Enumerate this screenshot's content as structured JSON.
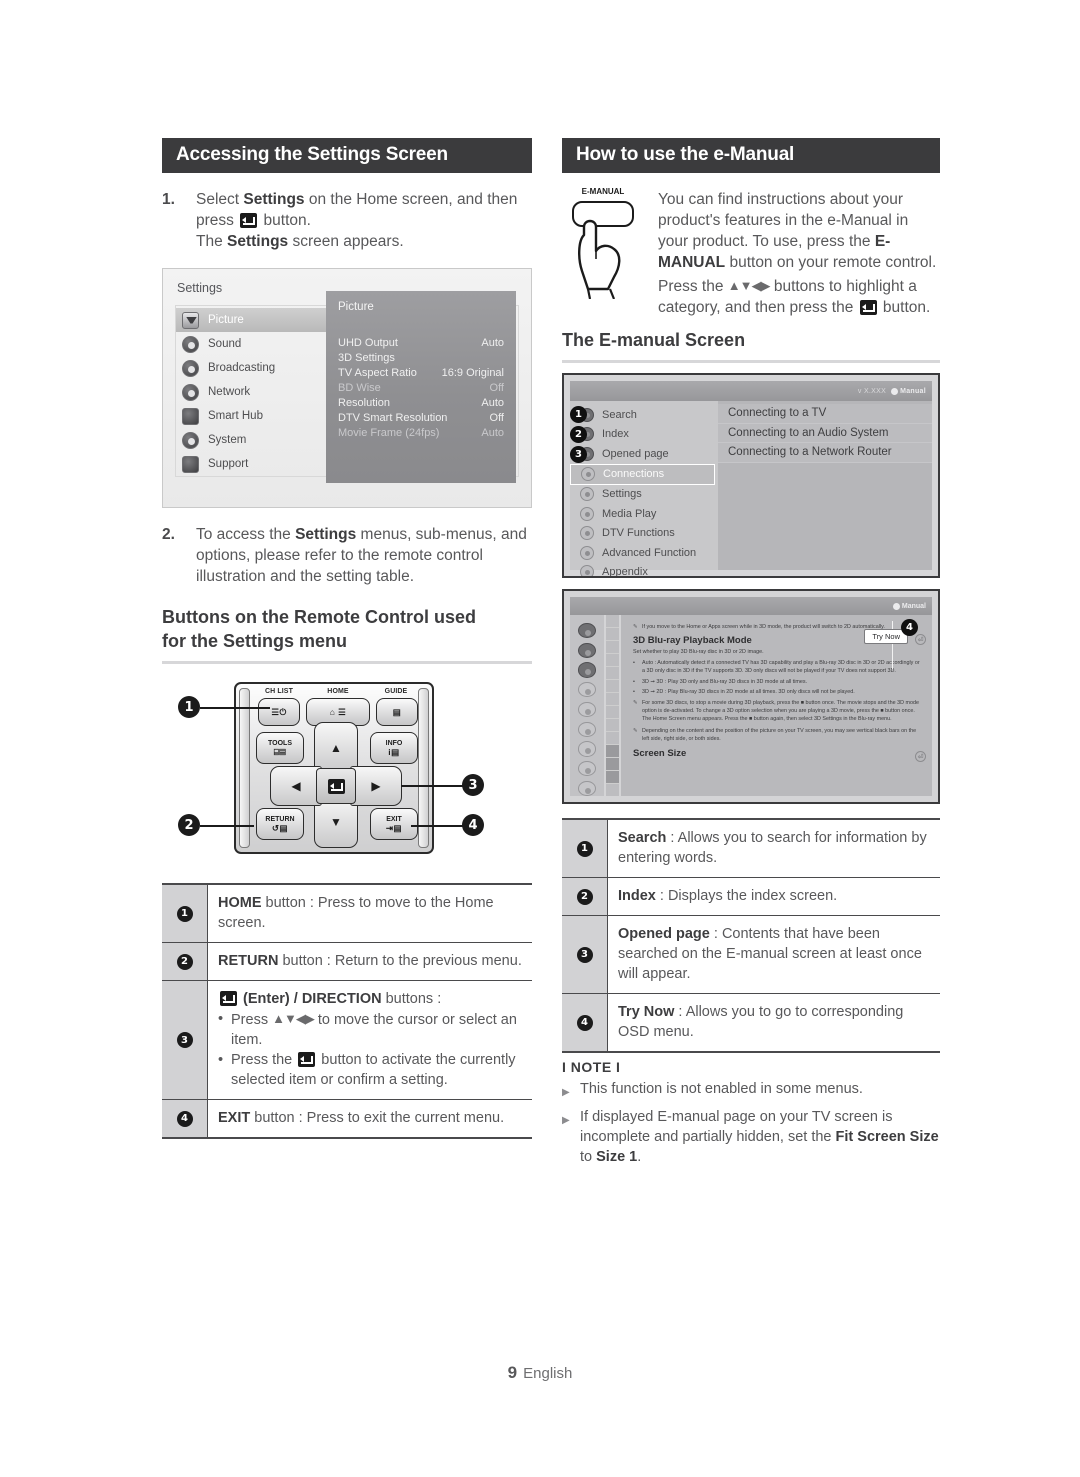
{
  "left": {
    "section_title": "Accessing the Settings Screen",
    "step1": {
      "num": "1.",
      "line1_a": "Select ",
      "line1_b": "Settings",
      "line1_c": " on the Home screen, and then press ",
      "line1_d": " button.",
      "line2_a": "The ",
      "line2_b": "Settings",
      "line2_c": " screen appears."
    },
    "settings_screen": {
      "title": "Settings",
      "menu": [
        {
          "label": "Picture",
          "icon": "picture-icon",
          "selected": true
        },
        {
          "label": "Sound",
          "icon": "sound-icon",
          "selected": false
        },
        {
          "label": "Broadcasting",
          "icon": "broadcasting-icon",
          "selected": false
        },
        {
          "label": "Network",
          "icon": "network-icon",
          "selected": false
        },
        {
          "label": "Smart Hub",
          "icon": "smart-hub-icon",
          "selected": false
        },
        {
          "label": "System",
          "icon": "system-icon",
          "selected": false
        },
        {
          "label": "Support",
          "icon": "support-icon",
          "selected": false
        }
      ],
      "panel_title": "Picture",
      "options": [
        {
          "name": "UHD Output",
          "value": "Auto",
          "dim": false
        },
        {
          "name": "3D Settings",
          "value": "",
          "dim": false
        },
        {
          "name": "TV Aspect Ratio",
          "value": "16:9 Original",
          "dim": false
        },
        {
          "name": "BD Wise",
          "value": "Off",
          "dim": true
        },
        {
          "name": "Resolution",
          "value": "Auto",
          "dim": false
        },
        {
          "name": "DTV Smart Resolution",
          "value": "Off",
          "dim": false
        },
        {
          "name": "Movie Frame (24fps)",
          "value": "Auto",
          "dim": true
        }
      ]
    },
    "step2": {
      "num": "2.",
      "text_a": "To access the ",
      "text_b": "Settings",
      "text_c": " menus, sub-menus, and options, please refer to the remote control illustration and the setting table."
    },
    "remote_heading_line1": "Buttons on the Remote Control used",
    "remote_heading_line2": "for the Settings menu",
    "remote": {
      "ch_list_label": "CH LIST",
      "home_label": "HOME",
      "guide_label": "GUIDE",
      "tools_label": "TOOLS",
      "info_label": "INFO",
      "return_label": "RETURN",
      "exit_label": "EXIT",
      "callouts": [
        "1",
        "2",
        "3",
        "4"
      ]
    },
    "table": [
      {
        "num": "1",
        "bold": "HOME",
        "rest": " button : Press to move to the Home screen."
      },
      {
        "num": "2",
        "bold": "RETURN",
        "rest": " button : Return to the previous menu."
      },
      {
        "num": "3",
        "head_bold": "(Enter) / DIRECTION",
        "head_rest": " buttons :",
        "bullet1_a": "Press ",
        "bullet1_b": " to move the cursor or select an item.",
        "bullet2_a": "Press the ",
        "bullet2_b": " button to activate the currently selected item or confirm a setting."
      },
      {
        "num": "4",
        "bold": "EXIT",
        "rest": " button : Press to exit the current menu."
      }
    ]
  },
  "right": {
    "section_title": "How to use the e-Manual",
    "emanual_key_label": "E-MANUAL",
    "intro": {
      "p1_a": "You can find instructions about your product's features in the e-Manual in your product. To use, press the ",
      "p1_b": "E-MANUAL",
      "p1_c": " button on your remote control.",
      "p2_a": "Press the ",
      "p2_b": " buttons to highlight a category, and then press the ",
      "p2_c": " button."
    },
    "screen_heading": "The E-manual Screen",
    "emanual_screen": {
      "version_text": "v X.XXX",
      "brand": "Manual",
      "nav": [
        {
          "label": "Search",
          "callout": "1",
          "selected": false
        },
        {
          "label": "Index",
          "callout": "2",
          "selected": false
        },
        {
          "label": "Opened page",
          "callout": "3",
          "selected": false
        },
        {
          "label": "Connections",
          "callout": "",
          "selected": true
        },
        {
          "label": "Settings",
          "callout": "",
          "selected": false
        },
        {
          "label": "Media Play",
          "callout": "",
          "selected": false
        },
        {
          "label": "DTV Functions",
          "callout": "",
          "selected": false
        },
        {
          "label": "Advanced Function",
          "callout": "",
          "selected": false
        },
        {
          "label": "Appendix",
          "callout": "",
          "selected": false
        }
      ],
      "list": [
        "Connecting to a TV",
        "Connecting to an Audio System",
        "Connecting to a Network Router"
      ]
    },
    "emanual_page": {
      "brand": "Manual",
      "note_top": "If you move to the Home or Apps screen while in 3D mode, the product will switch to 2D automatically.",
      "heading": "3D Blu-ray Playback Mode",
      "subtitle": "Set whether to play 3D Blu-ray disc in 3D or 2D image.",
      "bullets": [
        "Auto : Automatically detect if a connected TV has 3D capability and play a Blu-ray 3D disc in 3D or 2D accordingly or a 3D only disc in 3D if the TV supports 3D. 3D only discs will not be played if your TV does not support 3D.",
        "3D ➞ 3D : Play 3D only and Blu-ray 3D discs in 3D mode at all times.",
        "3D ➞ 2D : Play Blu-ray 3D discs in 2D mode at all times. 3D only discs will not be played."
      ],
      "notes": [
        "For some 3D discs, to stop a movie during 3D playback, press the ■ button once. The movie stops and the 3D mode option is de-activated. To change a 3D option selection when you are playing a 3D movie, press the ■ button once. The Home Screen menu appears. Press the ■ button again, then select 3D Settings in the Blu-ray menu.",
        "Depending on the content and the position of the picture on your TV screen, you may see vertical black bars on the left side, right side, or both sides."
      ],
      "footer_heading": "Screen Size",
      "try_now_label": "Try Now",
      "callout": "4"
    },
    "table": [
      {
        "num": "1",
        "bold": "Search",
        "rest": " : Allows you to search for information by entering words."
      },
      {
        "num": "2",
        "bold": "Index",
        "rest": " : Displays the index screen."
      },
      {
        "num": "3",
        "bold": "Opened page",
        "rest": " : Contents that have been searched on the E-manual screen at least once will appear."
      },
      {
        "num": "4",
        "bold": "Try Now",
        "rest": " : Allows you to go to corresponding OSD menu."
      }
    ],
    "note": {
      "title": "I NOTE I",
      "items": [
        {
          "a": "This function is not enabled in some menus.",
          "b": "",
          "c": "",
          "d": "",
          "e": ""
        },
        {
          "a": "If displayed E-manual page on your TV screen is incomplete and partially hidden, set the ",
          "b": "Fit Screen Size",
          "c": " to ",
          "d": "Size 1",
          "e": "."
        }
      ]
    }
  },
  "footer": {
    "page_number": "9",
    "language": "English"
  }
}
